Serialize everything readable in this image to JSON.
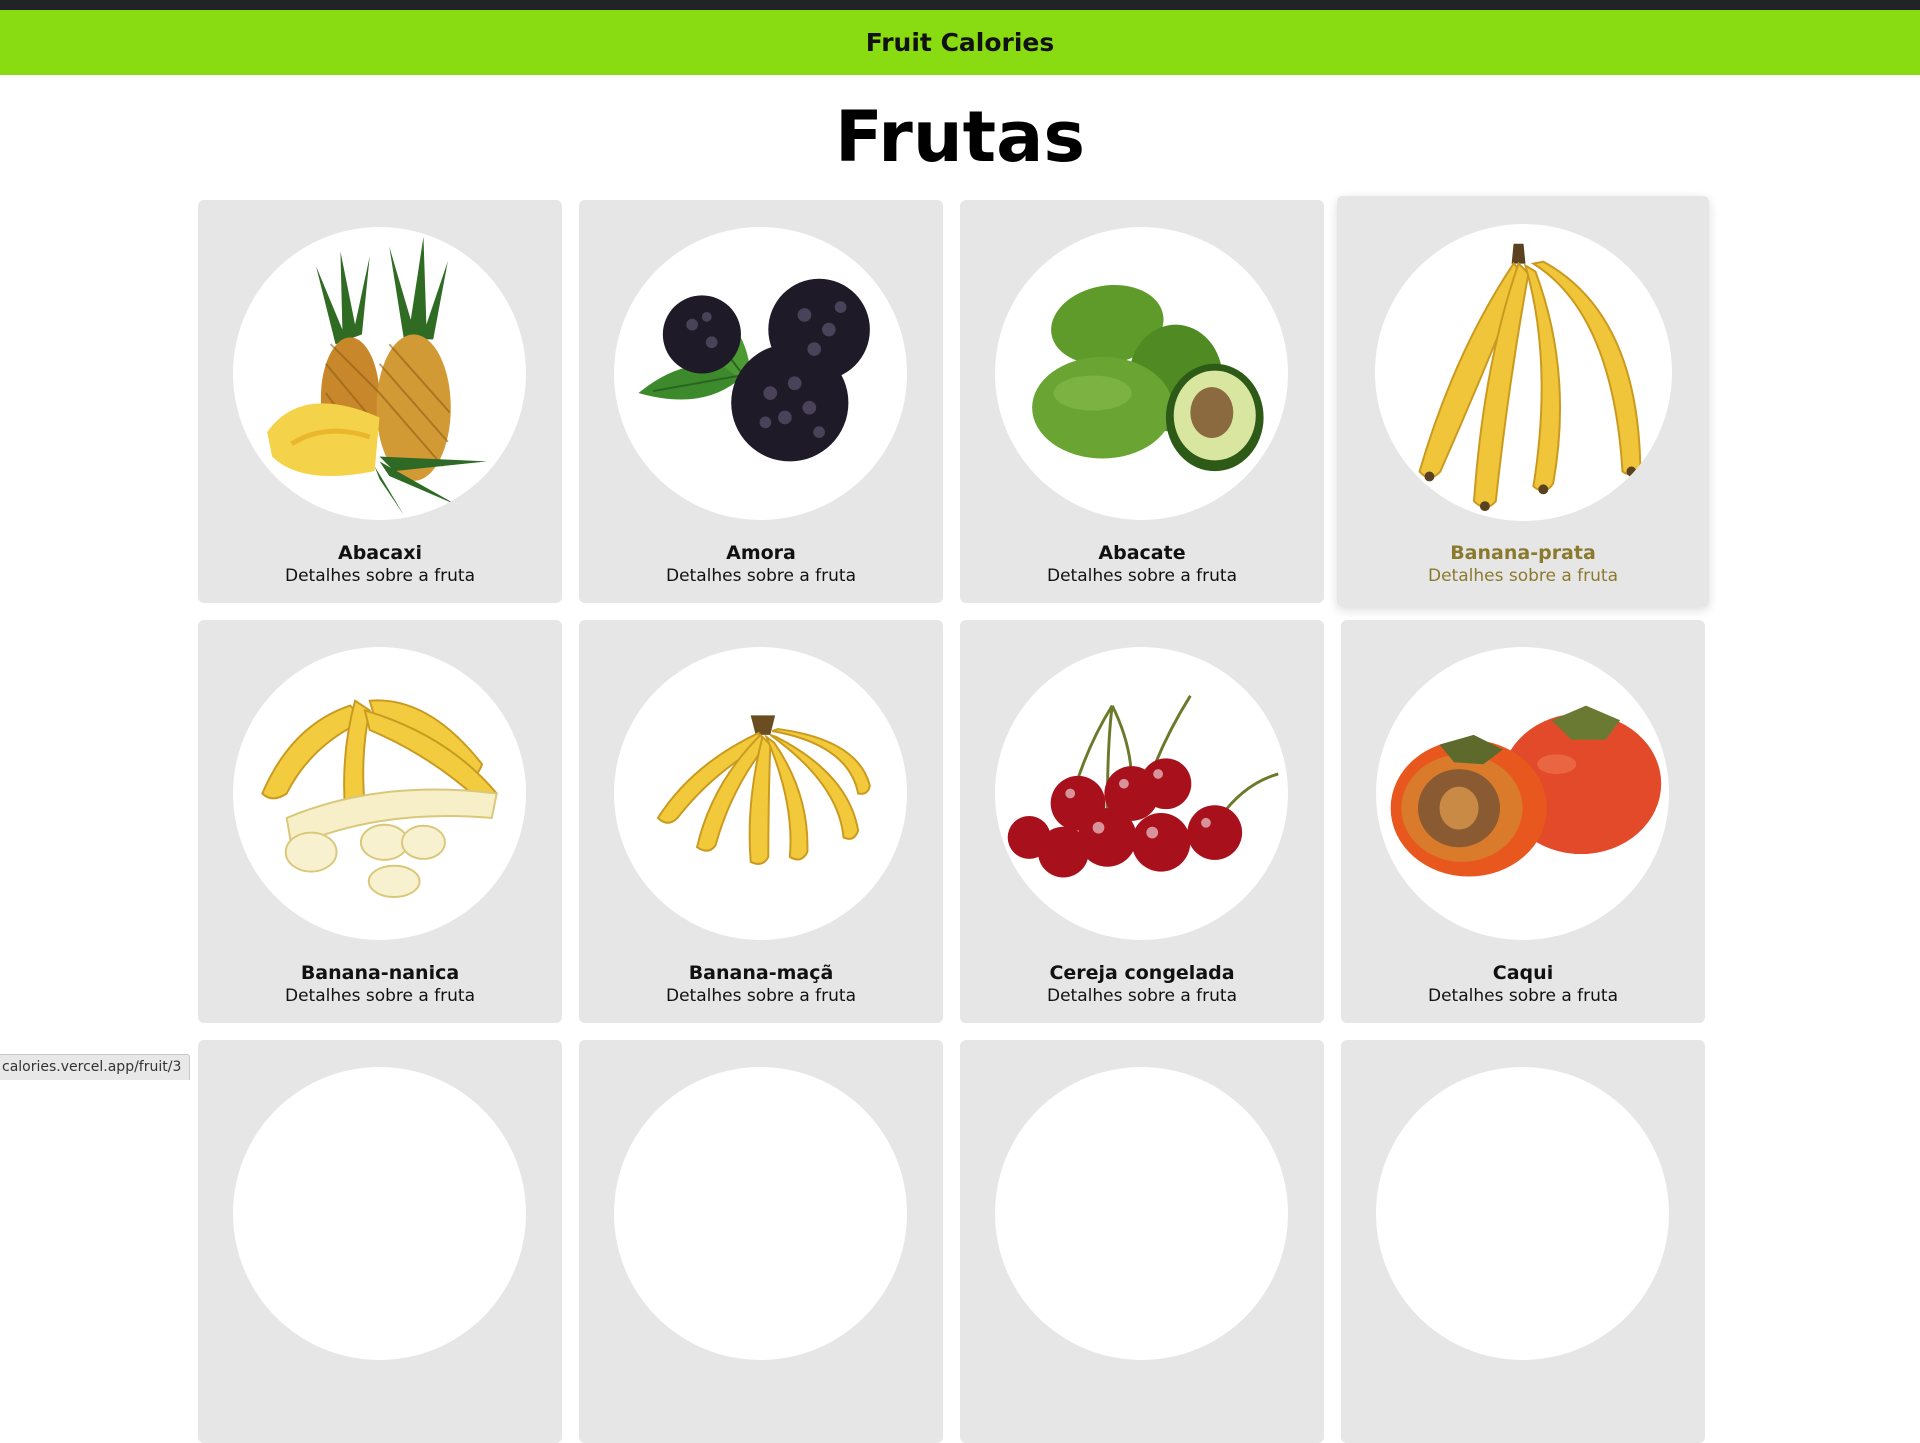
{
  "header": {
    "brand": "Fruit Calories",
    "accent": "#89dc12"
  },
  "page_title": "Frutas",
  "card_subtitle": "Detalhes sobre a fruta",
  "fruits": [
    {
      "name": "Abacaxi",
      "icon": "pineapple-icon"
    },
    {
      "name": "Amora",
      "icon": "blackberry-icon"
    },
    {
      "name": "Abacate",
      "icon": "avocado-icon"
    },
    {
      "name": "Banana-prata",
      "icon": "banana-bunch-icon",
      "hovered": true
    },
    {
      "name": "Banana-nanica",
      "icon": "peeled-banana-icon"
    },
    {
      "name": "Banana-maçã",
      "icon": "small-banana-bunch-icon"
    },
    {
      "name": "Cereja congelada",
      "icon": "cherries-icon"
    },
    {
      "name": "Caqui",
      "icon": "persimmon-icon"
    }
  ],
  "status_bar": {
    "url": "calories.vercel.app/fruit/3"
  }
}
